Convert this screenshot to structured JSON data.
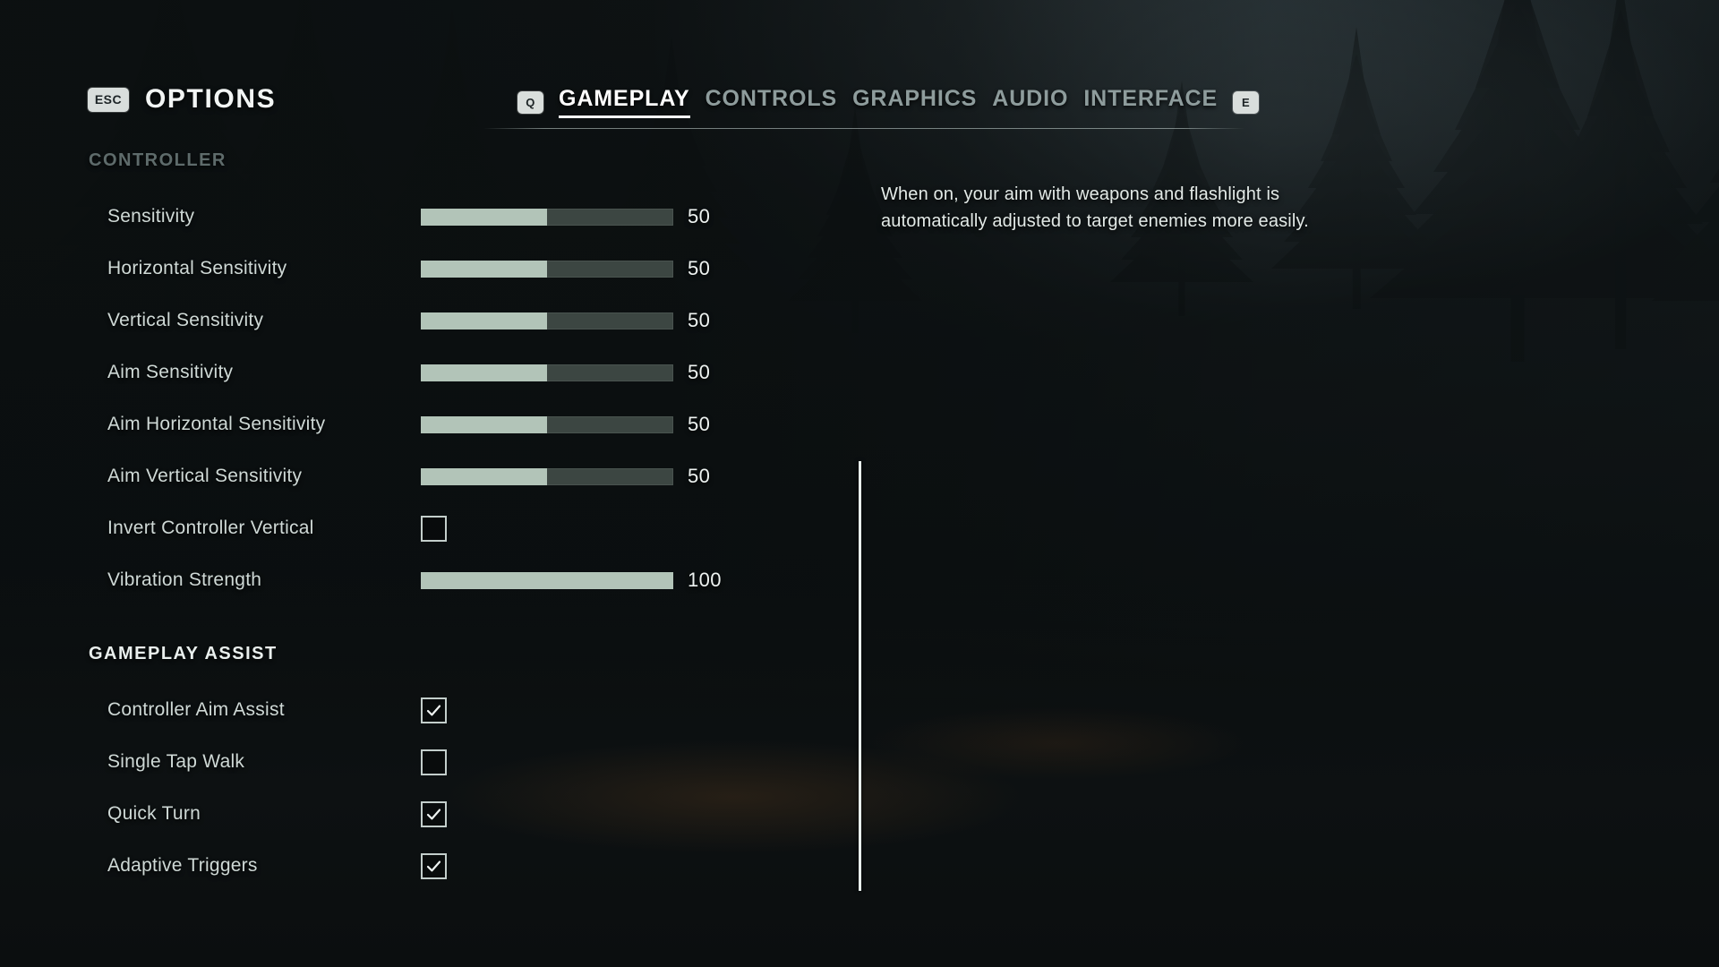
{
  "header": {
    "back_key": "ESC",
    "title": "OPTIONS",
    "prev_tab_key": "Q",
    "next_tab_key": "E"
  },
  "tabs": [
    {
      "label": "GAMEPLAY",
      "active": true
    },
    {
      "label": "CONTROLS",
      "active": false
    },
    {
      "label": "GRAPHICS",
      "active": false
    },
    {
      "label": "AUDIO",
      "active": false
    },
    {
      "label": "INTERFACE",
      "active": false
    }
  ],
  "groups": [
    {
      "title": "CONTROLLER",
      "emphasis": "dim",
      "rows": [
        {
          "label": "Sensitivity",
          "type": "slider",
          "value": 50,
          "percent": 50,
          "display": "50"
        },
        {
          "label": "Horizontal Sensitivity",
          "type": "slider",
          "value": 50,
          "percent": 50,
          "display": "50"
        },
        {
          "label": "Vertical Sensitivity",
          "type": "slider",
          "value": 50,
          "percent": 50,
          "display": "50"
        },
        {
          "label": "Aim Sensitivity",
          "type": "slider",
          "value": 50,
          "percent": 50,
          "display": "50"
        },
        {
          "label": "Aim Horizontal Sensitivity",
          "type": "slider",
          "value": 50,
          "percent": 50,
          "display": "50"
        },
        {
          "label": "Aim Vertical Sensitivity",
          "type": "slider",
          "value": 50,
          "percent": 50,
          "display": "50"
        },
        {
          "label": "Invert Controller Vertical",
          "type": "checkbox",
          "checked": false
        },
        {
          "label": "Vibration Strength",
          "type": "slider",
          "value": 100,
          "percent": 100,
          "display": "100"
        }
      ]
    },
    {
      "title": "GAMEPLAY ASSIST",
      "emphasis": "bright",
      "rows": [
        {
          "label": "Controller Aim Assist",
          "type": "checkbox",
          "checked": true
        },
        {
          "label": "Single Tap Walk",
          "type": "checkbox",
          "checked": false
        },
        {
          "label": "Quick Turn",
          "type": "checkbox",
          "checked": true
        },
        {
          "label": "Adaptive Triggers",
          "type": "checkbox",
          "checked": true
        }
      ]
    }
  ],
  "description": {
    "text": "When on, your aim with weapons and flashlight is automatically adjusted to target enemies more easily."
  },
  "colors": {
    "slider_fill": "#b2c4b8",
    "slider_track": "#3c4642",
    "active_tab": "#ffffff",
    "inactive_tab": "#8e9c9c",
    "label": "#cfd9d6",
    "keycap": "#d9dedc"
  }
}
